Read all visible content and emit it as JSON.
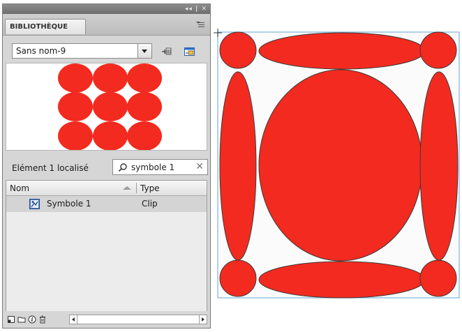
{
  "panel": {
    "tab_label": "BIBLIOTHÈQUE",
    "title_controls": "◂◂ | ✕",
    "document_select": "Sans nom-9",
    "status_text": "Elément 1 localisé",
    "search": {
      "value": "symbole 1",
      "placeholder": ""
    },
    "columns": {
      "name": "Nom",
      "type": "Type"
    },
    "items": [
      {
        "name": "Symbole 1",
        "type": "Clip",
        "icon": "movieclip-icon"
      }
    ]
  },
  "colors": {
    "fill": "#f32a1f",
    "stroke": "#3a3a3a",
    "selection": "#d4d4d4",
    "stage_border": "#7fb3dc"
  }
}
